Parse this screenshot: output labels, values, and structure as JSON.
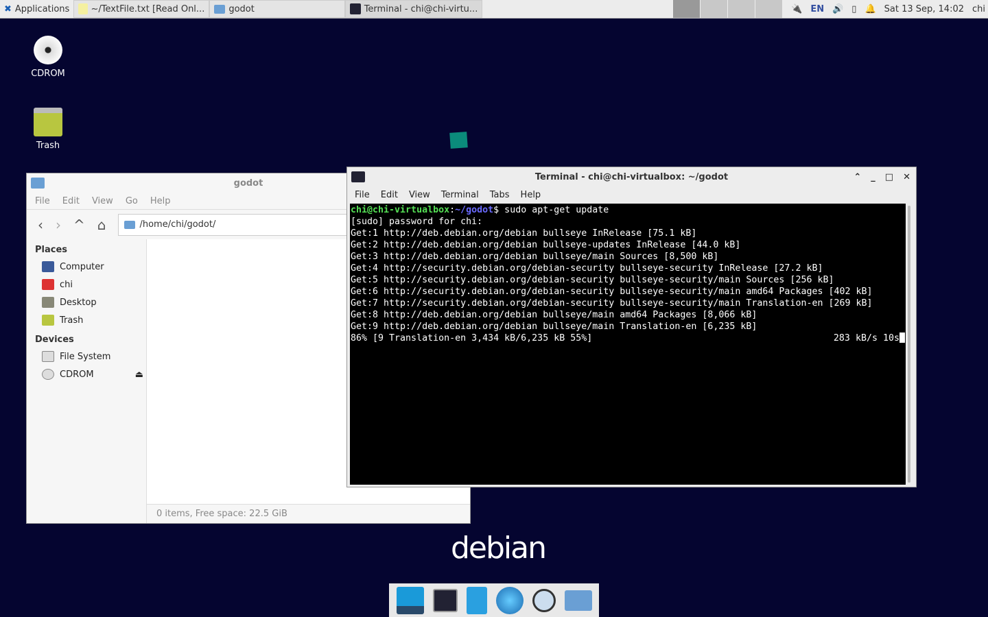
{
  "topbar": {
    "applications": "Applications",
    "tasks": [
      "~/TextFile.txt [Read Onl...",
      "godot",
      "Terminal - chi@chi-virtu..."
    ],
    "lang": "EN",
    "clock": "Sat 13 Sep, 14:02",
    "user": "chi"
  },
  "desktop": {
    "icons": [
      "CDROM",
      "Trash"
    ],
    "logo": "debian"
  },
  "filemanager": {
    "title": "godot",
    "menu": [
      "File",
      "Edit",
      "View",
      "Go",
      "Help"
    ],
    "path": "/home/chi/godot/",
    "places_header": "Places",
    "places": [
      "Computer",
      "chi",
      "Desktop",
      "Trash"
    ],
    "devices_header": "Devices",
    "devices": [
      "File System",
      "CDROM"
    ],
    "status": "0 items, Free space: 22.5 GiB"
  },
  "terminal": {
    "title": "Terminal - chi@chi-virtualbox: ~/godot",
    "menu": [
      "File",
      "Edit",
      "View",
      "Terminal",
      "Tabs",
      "Help"
    ],
    "prompt_user": "chi@chi-virtualbox",
    "prompt_path": "~/godot",
    "command": "$ sudo apt-get update",
    "lines": [
      "[sudo] password for chi:",
      "Get:1 http://deb.debian.org/debian bullseye InRelease [75.1 kB]",
      "Get:2 http://deb.debian.org/debian bullseye-updates InRelease [44.0 kB]",
      "Get:3 http://deb.debian.org/debian bullseye/main Sources [8,500 kB]",
      "Get:4 http://security.debian.org/debian-security bullseye-security InRelease [27.2 kB]",
      "Get:5 http://security.debian.org/debian-security bullseye-security/main Sources [256 kB]",
      "Get:6 http://security.debian.org/debian-security bullseye-security/main amd64 Packages [402 kB]",
      "Get:7 http://security.debian.org/debian-security bullseye-security/main Translation-en [269 kB]",
      "Get:8 http://deb.debian.org/debian bullseye/main amd64 Packages [8,066 kB]",
      "Get:9 http://deb.debian.org/debian bullseye/main Translation-en [6,235 kB]"
    ],
    "progress_left": "86% [9 Translation-en 3,434 kB/6,235 kB 55%]",
    "progress_right": "283 kB/s 10s"
  }
}
